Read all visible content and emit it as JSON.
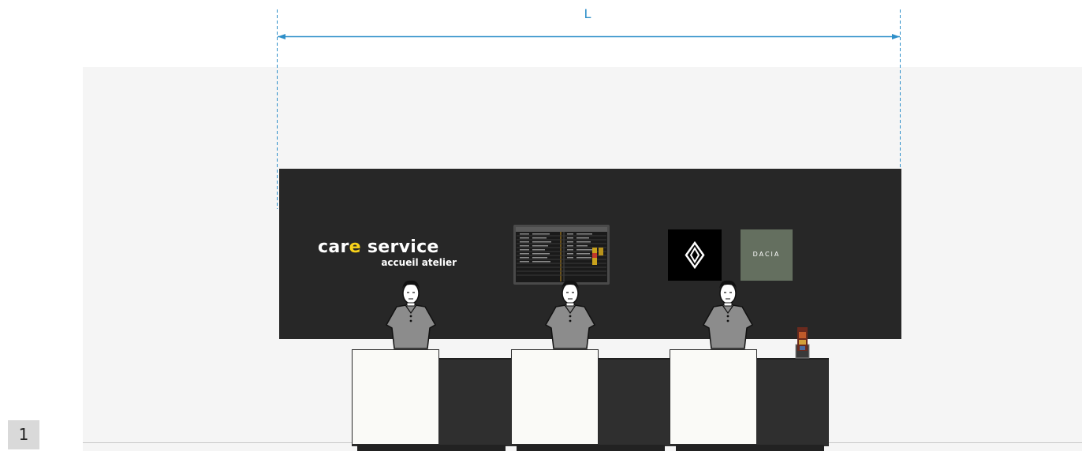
{
  "dimension": {
    "label": "L",
    "color": "#2e8fc9"
  },
  "signage": {
    "care_prefix": "car",
    "care_highlight": "e",
    "care_suffix": " service",
    "care_subtitle": "accueil atelier",
    "highlight_color": "#f8d21a",
    "dacia_text": "DACIA"
  },
  "screen": {
    "description_icon": "departure-board-icon"
  },
  "logos": {
    "renault": "renault-diamond-icon",
    "dacia_bg": "#646f5f"
  },
  "staff": [
    {
      "role": "receptionist"
    },
    {
      "role": "receptionist"
    },
    {
      "role": "receptionist"
    }
  ],
  "page": {
    "number": "1"
  },
  "colors": {
    "wall": "#272727",
    "room": "#f5f5f5",
    "counter": "#2f2f2f",
    "desk_front": "#fafaf7"
  }
}
